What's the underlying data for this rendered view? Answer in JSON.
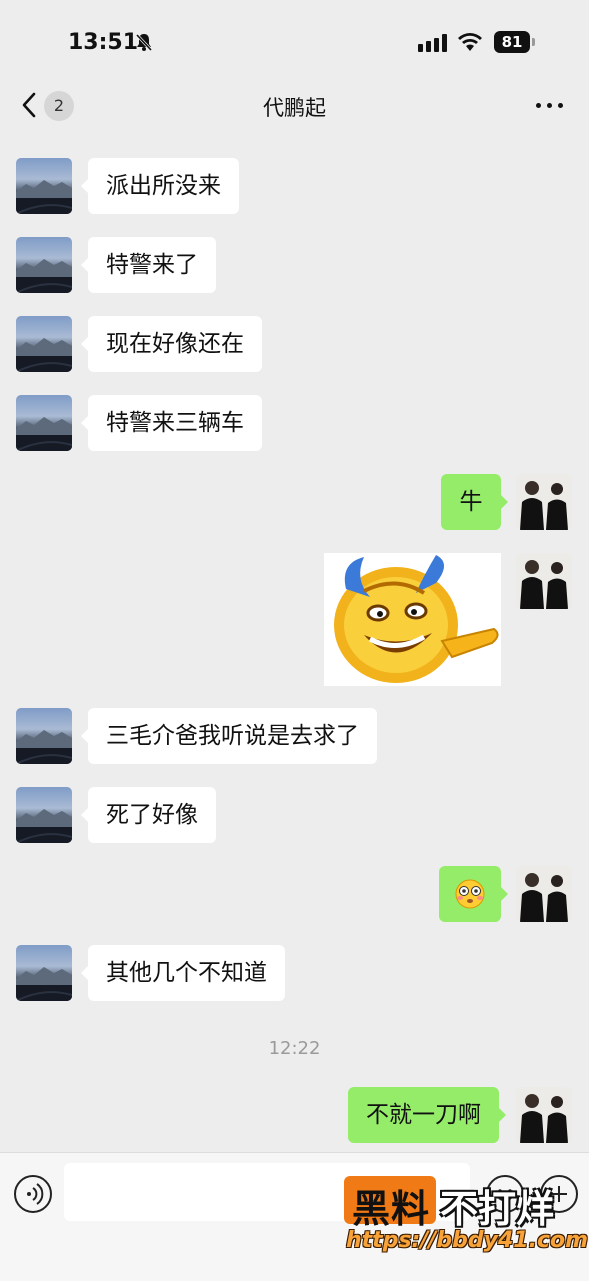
{
  "status_bar": {
    "time": "13:51",
    "battery": "81"
  },
  "nav": {
    "back_badge": "2",
    "title": "代鹏起"
  },
  "messages": [
    {
      "side": "in",
      "text": "派出所没来"
    },
    {
      "side": "in",
      "text": "特警来了"
    },
    {
      "side": "in",
      "text": "现在好像还在"
    },
    {
      "side": "in",
      "text": "特警来三辆车"
    },
    {
      "side": "out",
      "text": "牛"
    },
    {
      "side": "out",
      "type": "sticker",
      "text": ""
    },
    {
      "side": "in",
      "text": "三毛介爸我听说是去求了"
    },
    {
      "side": "in",
      "text": "死了好像"
    },
    {
      "side": "out",
      "type": "emoji",
      "text": "😳"
    },
    {
      "side": "in",
      "text": "其他几个不知道"
    },
    {
      "type": "time",
      "text": "12:22"
    },
    {
      "side": "out",
      "text": "不就一刀啊"
    }
  ],
  "input": {
    "placeholder": ""
  },
  "watermark": {
    "line1_a": "黑料",
    "line1_b": "不打烊",
    "url": "https://bbdy41.com"
  },
  "colors": {
    "background": "#ededed",
    "outgoing_bubble": "#95ec69",
    "incoming_bubble": "#ffffff"
  },
  "icons": [
    "back-arrow-icon",
    "more-icon",
    "voice-icon",
    "emoji-icon",
    "plus-icon",
    "mute-bell-icon",
    "signal-icon",
    "wifi-icon",
    "battery-icon"
  ]
}
